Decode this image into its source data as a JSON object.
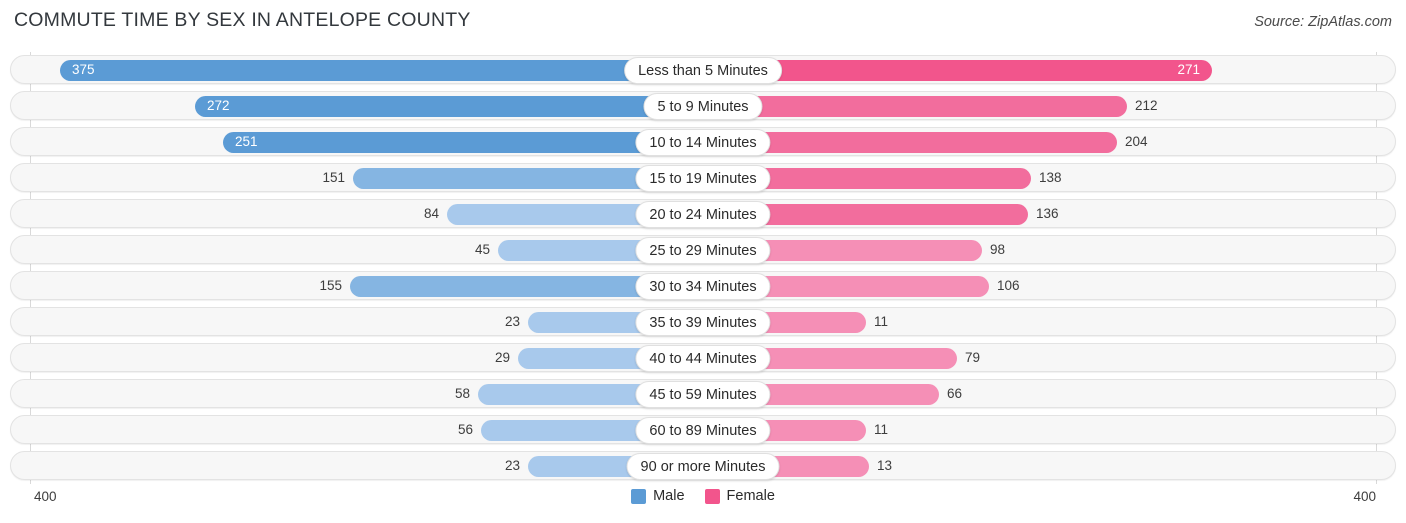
{
  "header": {
    "title": "COMMUTE TIME BY SEX IN ANTELOPE COUNTY",
    "source": "Source: ZipAtlas.com"
  },
  "axis": {
    "left_label": "400",
    "right_label": "400"
  },
  "legend": {
    "items": [
      {
        "label": "Male",
        "color": "#5b9bd5"
      },
      {
        "label": "Female",
        "color": "#f2558c"
      }
    ]
  },
  "colors": {
    "male_strong": "#5b9bd5",
    "male_mid": "#85b5e2",
    "male_light": "#a8c9ec",
    "female_strong": "#f2558c",
    "female_mid": "#f26d9d",
    "female_light": "#f58fb6"
  },
  "chart_data": {
    "type": "bar",
    "title": "COMMUTE TIME BY SEX IN ANTELOPE COUNTY",
    "subtitle": "Source: ZipAtlas.com",
    "orientation": "horizontal-diverging",
    "xlabel": "",
    "ylabel": "",
    "xlim": [
      400,
      400
    ],
    "axis_max": 400,
    "grid": true,
    "legend_position": "bottom-center",
    "categories": [
      "Less than 5 Minutes",
      "5 to 9 Minutes",
      "10 to 14 Minutes",
      "15 to 19 Minutes",
      "20 to 24 Minutes",
      "25 to 29 Minutes",
      "30 to 34 Minutes",
      "35 to 39 Minutes",
      "40 to 44 Minutes",
      "45 to 59 Minutes",
      "60 to 89 Minutes",
      "90 or more Minutes"
    ],
    "series": [
      {
        "name": "Male",
        "values": [
          375,
          272,
          251,
          151,
          84,
          45,
          155,
          23,
          29,
          58,
          56,
          23
        ]
      },
      {
        "name": "Female",
        "values": [
          271,
          212,
          204,
          138,
          136,
          98,
          106,
          11,
          79,
          66,
          11,
          13
        ]
      }
    ]
  },
  "rows": [
    {
      "label": "Less than 5 Minutes",
      "male": "375",
      "female": "271",
      "male_w": 643,
      "female_w": 509,
      "male_shade": "male_strong",
      "female_shade": "female_strong",
      "male_inside": true,
      "female_inside": true
    },
    {
      "label": "5 to 9 Minutes",
      "male": "272",
      "female": "212",
      "male_w": 508,
      "female_w": 424,
      "male_shade": "male_strong",
      "female_shade": "female_mid",
      "male_inside": true,
      "female_inside": false
    },
    {
      "label": "10 to 14 Minutes",
      "male": "251",
      "female": "204",
      "male_w": 480,
      "female_w": 414,
      "male_shade": "male_strong",
      "female_shade": "female_mid",
      "male_inside": true,
      "female_inside": false
    },
    {
      "label": "15 to 19 Minutes",
      "male": "151",
      "female": "138",
      "male_w": 350,
      "female_w": 328,
      "male_shade": "male_mid",
      "female_shade": "female_mid",
      "male_inside": false,
      "female_inside": false
    },
    {
      "label": "20 to 24 Minutes",
      "male": "84",
      "female": "136",
      "male_w": 256,
      "female_w": 325,
      "male_shade": "male_light",
      "female_shade": "female_mid",
      "male_inside": false,
      "female_inside": false
    },
    {
      "label": "25 to 29 Minutes",
      "male": "45",
      "female": "98",
      "male_w": 205,
      "female_w": 279,
      "male_shade": "male_light",
      "female_shade": "female_light",
      "male_inside": false,
      "female_inside": false
    },
    {
      "label": "30 to 34 Minutes",
      "male": "155",
      "female": "106",
      "male_w": 353,
      "female_w": 286,
      "male_shade": "male_mid",
      "female_shade": "female_light",
      "male_inside": false,
      "female_inside": false
    },
    {
      "label": "35 to 39 Minutes",
      "male": "23",
      "female": "11",
      "male_w": 175,
      "female_w": 163,
      "male_shade": "male_light",
      "female_shade": "female_light",
      "male_inside": false,
      "female_inside": false
    },
    {
      "label": "40 to 44 Minutes",
      "male": "29",
      "female": "79",
      "male_w": 185,
      "female_w": 254,
      "male_shade": "male_light",
      "female_shade": "female_light",
      "male_inside": false,
      "female_inside": false
    },
    {
      "label": "45 to 59 Minutes",
      "male": "58",
      "female": "66",
      "male_w": 225,
      "female_w": 236,
      "male_shade": "male_light",
      "female_shade": "female_light",
      "male_inside": false,
      "female_inside": false
    },
    {
      "label": "60 to 89 Minutes",
      "male": "56",
      "female": "11",
      "male_w": 222,
      "female_w": 163,
      "male_shade": "male_light",
      "female_shade": "female_light",
      "male_inside": false,
      "female_inside": false
    },
    {
      "label": "90 or more Minutes",
      "male": "23",
      "female": "13",
      "male_w": 175,
      "female_w": 166,
      "male_shade": "male_light",
      "female_shade": "female_light",
      "male_inside": false,
      "female_inside": false
    }
  ]
}
